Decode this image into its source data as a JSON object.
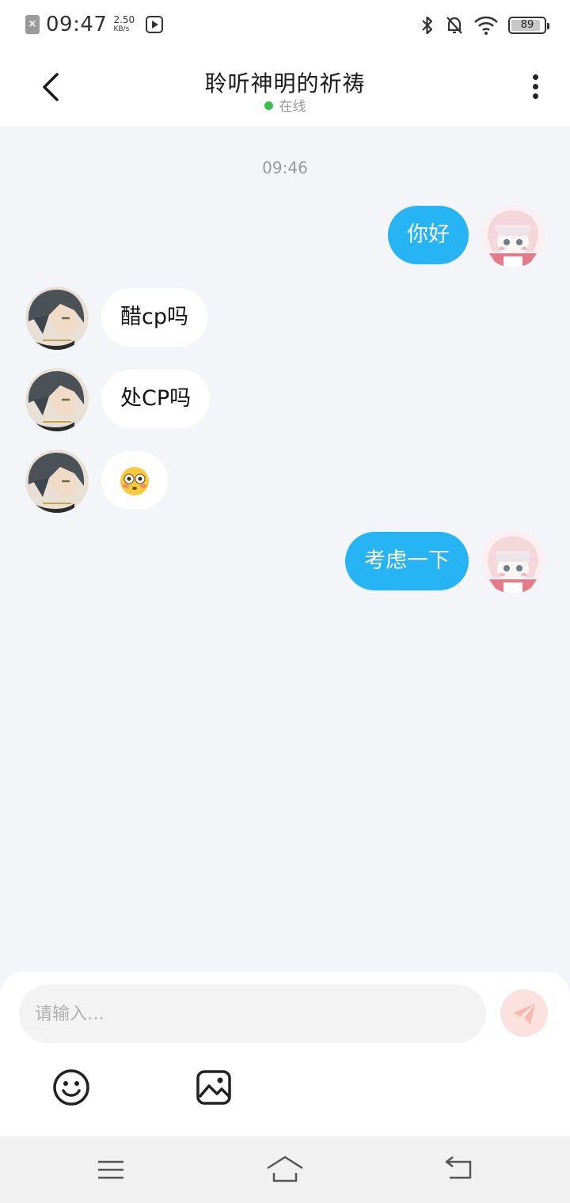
{
  "status_bar": {
    "time": "09:47",
    "speed_value": "2.50",
    "speed_unit": "KB/s",
    "battery": "89"
  },
  "header": {
    "title": "聆听神明的祈祷",
    "status": "在线"
  },
  "chat": {
    "timestamp": "09:46",
    "messages": [
      {
        "direction": "out",
        "text": "你好"
      },
      {
        "direction": "in",
        "text": "醋cp吗"
      },
      {
        "direction": "in",
        "text": "处CP吗"
      },
      {
        "direction": "in",
        "text": "😳"
      },
      {
        "direction": "out",
        "text": "考虑一下"
      }
    ]
  },
  "composer": {
    "placeholder": "请输入…"
  },
  "colors": {
    "outgoing_bubble": "#27b4f5",
    "incoming_bubble": "#ffffff",
    "online_dot": "#3ac04c",
    "send_button": "#fce2df"
  },
  "icons": [
    "back-icon",
    "more-icon",
    "bluetooth-icon",
    "mute-icon",
    "wifi-icon",
    "battery-icon",
    "emoji-icon",
    "image-icon",
    "send-icon",
    "menu-icon",
    "home-icon",
    "return-icon"
  ]
}
